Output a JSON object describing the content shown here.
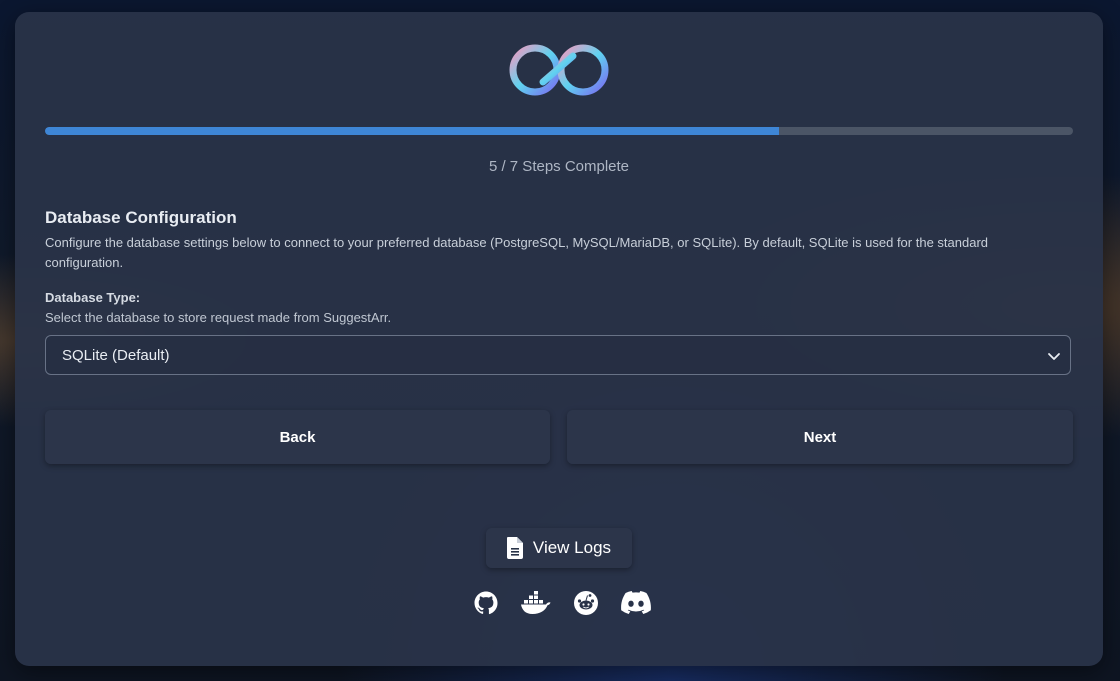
{
  "progress": {
    "completed_steps": 5,
    "total_steps": 7,
    "fraction": 0.714,
    "label": "5 / 7 Steps Complete"
  },
  "section": {
    "title": "Database Configuration",
    "description": "Configure the database settings below to connect to your preferred database (PostgreSQL, MySQL/MariaDB, or SQLite). By default, SQLite is used for the standard configuration."
  },
  "database_type": {
    "label": "Database Type:",
    "help": "Select the database to store request made from SuggestArr.",
    "selected": "SQLite (Default)"
  },
  "buttons": {
    "back": "Back",
    "next": "Next",
    "view_logs": "View Logs"
  },
  "socials": [
    "github-icon",
    "docker-icon",
    "reddit-icon",
    "discord-icon"
  ],
  "colors": {
    "accent": "#3e86d6",
    "card": "#293348",
    "logo_gradient": [
      "#f39ac0",
      "#5fd3f0",
      "#7a6cf0"
    ]
  }
}
